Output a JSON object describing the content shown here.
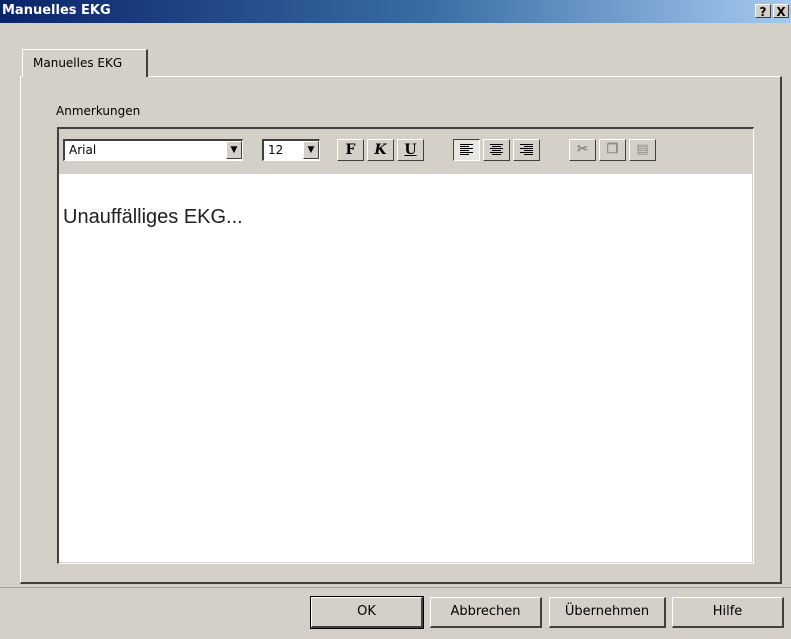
{
  "window": {
    "title": "Manuelles EKG",
    "help_label": "?",
    "close_label": "X"
  },
  "tabs": [
    {
      "label": "Manuelles EKG",
      "active": true
    }
  ],
  "notes": {
    "label": "Anmerkungen",
    "font_family": "Arial",
    "font_size": "12",
    "format_buttons": {
      "bold": "F",
      "italic": "K",
      "underline": "U"
    },
    "alignment": {
      "selected": "left",
      "options": [
        "left",
        "center",
        "right"
      ]
    },
    "clipboard_icons": [
      "cut-icon",
      "copy-icon",
      "paste-icon"
    ],
    "text": "Unauffälliges EKG..."
  },
  "buttons": {
    "ok": "OK",
    "cancel": "Abbrechen",
    "apply": "Übernehmen",
    "help": "Hilfe"
  },
  "colors": {
    "dialog_bg": "#d4d0c8",
    "title_start": "#0a246a",
    "title_end": "#a6caf0"
  }
}
